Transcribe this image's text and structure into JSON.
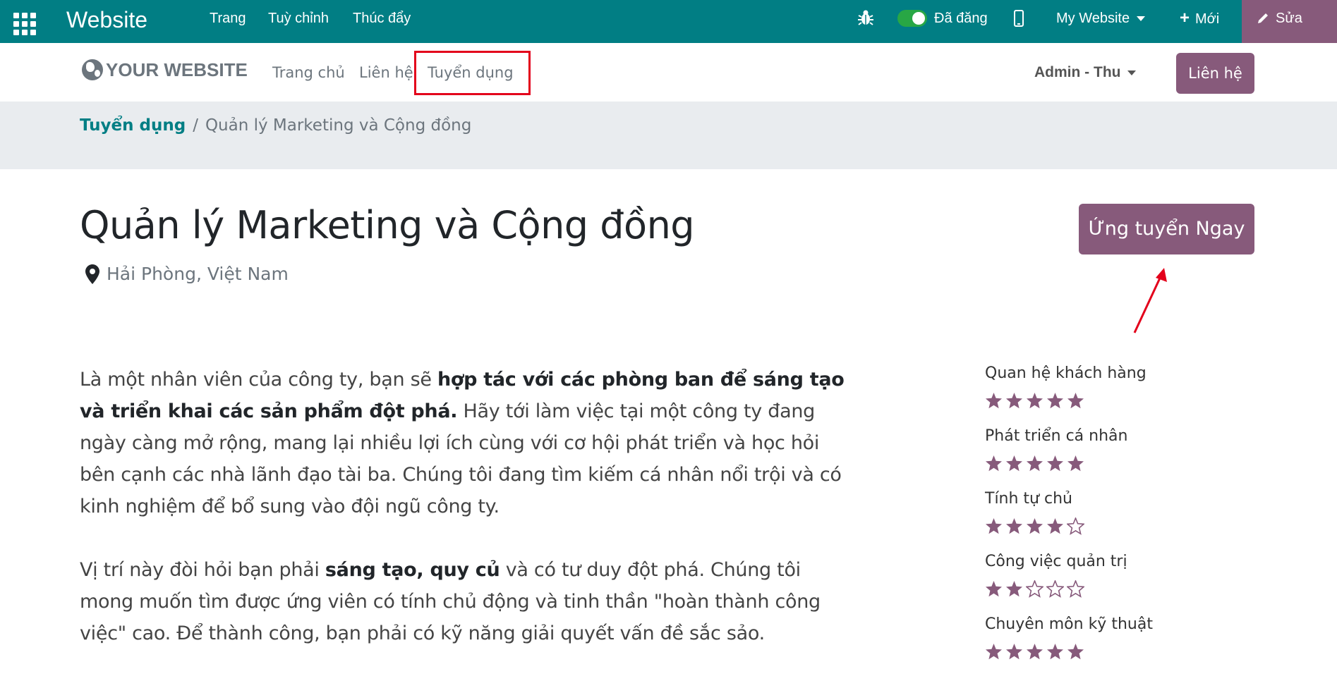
{
  "topbar": {
    "brand": "Website",
    "menu": [
      "Trang",
      "Tuỳ chỉnh",
      "Thúc đẩy"
    ],
    "published_label": "Đã đăng",
    "site_selector": "My Website",
    "new_label": "Mới",
    "edit_label": "Sửa",
    "colors": {
      "bar": "#017e84",
      "edit": "#875a7b",
      "toggle": "#28a745"
    }
  },
  "header": {
    "logo_text": "YOUR WEBSITE",
    "nav": [
      "Trang chủ",
      "Liên hệ",
      "Tuyển dụng"
    ],
    "user_menu": "Admin - Thu",
    "contact_button": "Liên hệ",
    "highlight_color": "#e3001b"
  },
  "breadcrumb": {
    "items": [
      "Tuyển dụng",
      "Quản lý Marketing và Cộng đồng"
    ],
    "separator": "/"
  },
  "job": {
    "title": "Quản lý Marketing và Cộng đồng",
    "location": "Hải Phòng, Việt Nam",
    "apply_button": "Ứng tuyển Ngay"
  },
  "description": {
    "p1": [
      "Là một nhân viên của công ty, bạn sẽ ",
      "hợp tác với các phòng ban để sáng tạo và triển khai các sản phẩm đột phá.",
      " Hãy tới làm việc tại một công ty đang ngày càng mở rộng, mang lại nhiều lợi ích cùng với cơ hội phát triển và học hỏi bên cạnh các nhà lãnh đạo tài ba. Chúng tôi đang tìm kiếm cá nhân nổi trội và có kinh nghiệm để bổ sung vào đội ngũ công ty."
    ],
    "p2": [
      "Vị trí này đòi hỏi bạn phải ",
      "sáng tạo, quy củ",
      " và có tư duy đột phá. Chúng tôi mong muốn tìm được ứng viên có tính chủ động và tinh thần \"hoàn thành công việc\" cao. Để thành công, bạn phải có kỹ năng giải quyết vấn đề sắc sảo."
    ]
  },
  "skills": [
    {
      "label": "Quan hệ khách hàng",
      "rating": 5,
      "max": 5
    },
    {
      "label": "Phát triển cá nhân",
      "rating": 5,
      "max": 5
    },
    {
      "label": "Tính tự chủ",
      "rating": 4,
      "max": 5
    },
    {
      "label": "Công việc quản trị",
      "rating": 2,
      "max": 5
    },
    {
      "label": "Chuyên môn kỹ thuật",
      "rating": 5,
      "max": 5
    }
  ],
  "icons": {
    "apps": "apps-grid-icon",
    "debug": "bug-icon",
    "mobile": "mobile-icon",
    "plus": "plus-icon",
    "edit": "pencil-icon",
    "logo": "globe-icon",
    "location": "map-marker-icon",
    "star": "star-icon",
    "annotation": "red-arrow-icon"
  },
  "accent_color": "#875a7b"
}
